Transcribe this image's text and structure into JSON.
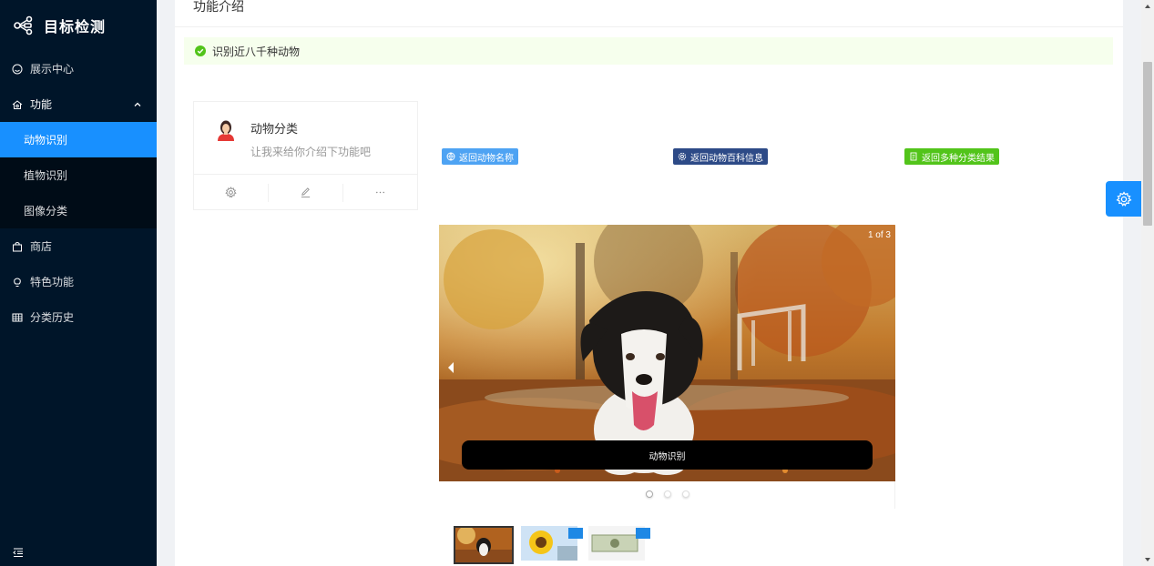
{
  "app": {
    "title": "目标检测"
  },
  "sidebar": {
    "items": [
      {
        "label": "展示中心",
        "icon": "smile-icon"
      },
      {
        "label": "功能",
        "icon": "function-icon",
        "expanded": true,
        "children": [
          {
            "label": "动物识别",
            "active": true
          },
          {
            "label": "植物识别"
          },
          {
            "label": "图像分类"
          }
        ]
      },
      {
        "label": "商店",
        "icon": "shop-icon"
      },
      {
        "label": "特色功能",
        "icon": "bulb-icon"
      },
      {
        "label": "分类历史",
        "icon": "table-icon"
      }
    ]
  },
  "page": {
    "header": "功能介绍",
    "alert": "识别近八千种动物"
  },
  "profile": {
    "title": "动物分类",
    "description": "让我来给你介绍下功能吧"
  },
  "tags": [
    {
      "label": "返回动物名称",
      "color": "#4ea3f3",
      "icon": "globe-icon"
    },
    {
      "label": "返回动物百科信息",
      "color": "#2d4a87",
      "icon": "gear-icon"
    },
    {
      "label": "返回多种分类结果",
      "color": "#52c41a",
      "icon": "document-icon"
    }
  ],
  "carousel": {
    "counter": "1 of 3",
    "caption": "动物识别",
    "slides": 3,
    "active": 1
  },
  "colors": {
    "sidebar_bg": "#001529",
    "active": "#1890ff",
    "alert_bg": "#f6ffed"
  }
}
